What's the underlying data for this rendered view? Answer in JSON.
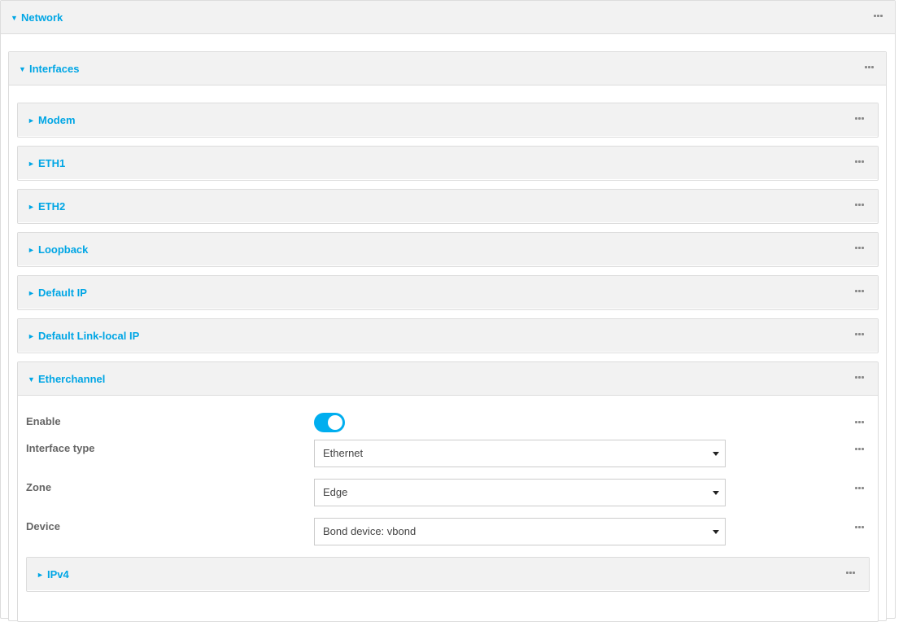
{
  "network": {
    "title": "Network",
    "expanded": true
  },
  "interfaces": {
    "title": "Interfaces",
    "expanded": true,
    "items": [
      {
        "label": "Modem",
        "expanded": false
      },
      {
        "label": "ETH1",
        "expanded": false
      },
      {
        "label": "ETH2",
        "expanded": false
      },
      {
        "label": "Loopback",
        "expanded": false
      },
      {
        "label": "Default IP",
        "expanded": false
      },
      {
        "label": "Default Link-local IP",
        "expanded": false
      }
    ]
  },
  "etherchannel": {
    "title": "Etherchannel",
    "expanded": true,
    "fields": {
      "enable": {
        "label": "Enable",
        "value": true
      },
      "interface_type": {
        "label": "Interface type",
        "value": "Ethernet"
      },
      "zone": {
        "label": "Zone",
        "value": "Edge"
      },
      "device": {
        "label": "Device",
        "value": "Bond device: vbond"
      }
    },
    "ipv4": {
      "title": "IPv4",
      "expanded": false
    }
  },
  "icons": {
    "expanded_arrow": "▼",
    "collapsed_arrow": "►",
    "menu": "more-dots-icon"
  },
  "colors": {
    "accent": "#00a6e5",
    "toggle_on": "#00aeef",
    "header_bg": "#f2f2f2",
    "border": "#dcdcdc"
  }
}
